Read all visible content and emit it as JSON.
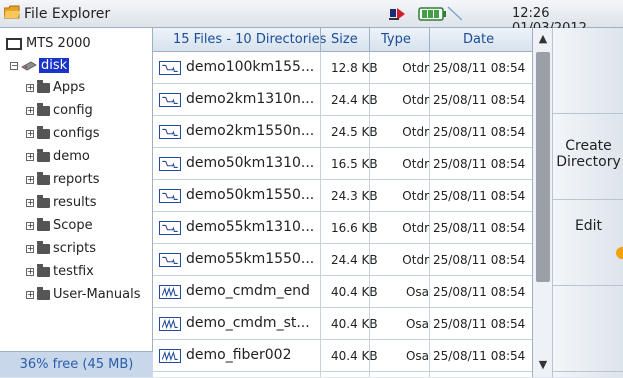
{
  "titlebar": {
    "title": "File Explorer",
    "clock": "12:26 01/03/2012",
    "status_icon": "remote-connection-icon",
    "battery_icon": "battery-icon"
  },
  "tree": {
    "root": "MTS 2000",
    "disk": "disk",
    "folders": [
      "Apps",
      "config",
      "configs",
      "demo",
      "reports",
      "results",
      "Scope",
      "scripts",
      "testfix",
      "User-Manuals"
    ],
    "free_space": "36% free (45 MB)"
  },
  "list": {
    "summary": "15 Files - 10 Directories",
    "col_size": "Size",
    "col_type": "Type",
    "col_date": "Date",
    "files": [
      {
        "name": "demo100km155...",
        "size": "12.8 KB",
        "type": "Otdr",
        "date": "25/08/11 08:54",
        "icon": "otdr-trace-icon"
      },
      {
        "name": "demo2km1310n...",
        "size": "24.4 KB",
        "type": "Otdr",
        "date": "25/08/11 08:54",
        "icon": "otdr-trace-icon"
      },
      {
        "name": "demo2km1550n...",
        "size": "24.5 KB",
        "type": "Otdr",
        "date": "25/08/11 08:54",
        "icon": "otdr-trace-icon"
      },
      {
        "name": "demo50km1310...",
        "size": "16.5 KB",
        "type": "Otdr",
        "date": "25/08/11 08:54",
        "icon": "otdr-trace-icon"
      },
      {
        "name": "demo50km1550...",
        "size": "24.3 KB",
        "type": "Otdr",
        "date": "25/08/11 08:54",
        "icon": "otdr-trace-icon"
      },
      {
        "name": "demo55km1310...",
        "size": "16.6 KB",
        "type": "Otdr",
        "date": "25/08/11 08:54",
        "icon": "otdr-trace-icon"
      },
      {
        "name": "demo55km1550...",
        "size": "24.4 KB",
        "type": "Otdr",
        "date": "25/08/11 08:54",
        "icon": "otdr-trace-icon"
      },
      {
        "name": "demo_cmdm_end",
        "size": "40.4 KB",
        "type": "Osa",
        "date": "25/08/11 08:54",
        "icon": "osa-spectrum-icon"
      },
      {
        "name": "demo_cmdm_st...",
        "size": "40.4 KB",
        "type": "Osa",
        "date": "25/08/11 08:54",
        "icon": "osa-spectrum-icon"
      },
      {
        "name": "demo_fiber002",
        "size": "40.4 KB",
        "type": "Osa",
        "date": "25/08/11 08:54",
        "icon": "osa-spectrum-icon"
      }
    ]
  },
  "softkeys": {
    "create_directory_line1": "Create",
    "create_directory_line2": "Directory",
    "edit": "Edit"
  }
}
